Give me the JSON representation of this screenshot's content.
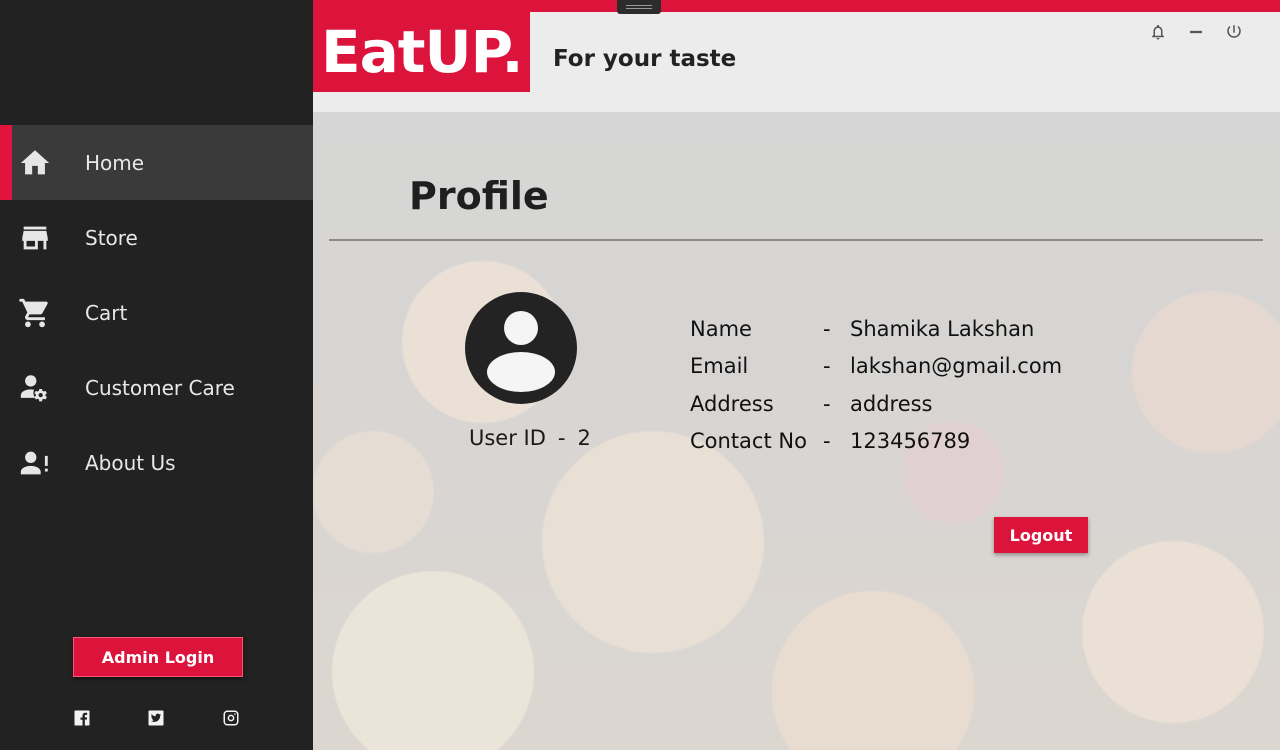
{
  "brand": {
    "logo_text": "EatUP.",
    "tagline": "For your taste"
  },
  "sidebar": {
    "items": [
      {
        "label": "Home",
        "icon": "home-icon",
        "active": true
      },
      {
        "label": "Store",
        "icon": "store-icon",
        "active": false
      },
      {
        "label": "Cart",
        "icon": "cart-icon",
        "active": false
      },
      {
        "label": "Customer Care",
        "icon": "user-gear-icon",
        "active": false
      },
      {
        "label": "About Us",
        "icon": "user-alert-icon",
        "active": false
      }
    ],
    "admin_login_label": "Admin Login",
    "social": [
      "facebook-icon",
      "twitter-icon",
      "instagram-icon"
    ]
  },
  "window_controls": [
    "bell-icon",
    "minimize-icon",
    "power-icon"
  ],
  "profile": {
    "title": "Profile",
    "user_id_label": "User ID",
    "user_id_sep": "-",
    "user_id_value": "2",
    "fields": [
      {
        "label": "Name",
        "sep": "-",
        "value": "Shamika Lakshan"
      },
      {
        "label": "Email",
        "sep": "-",
        "value": "lakshan@gmail.com"
      },
      {
        "label": "Address",
        "sep": "-",
        "value": "address"
      },
      {
        "label": "Contact No",
        "sep": "-",
        "value": "123456789"
      }
    ],
    "logout_label": "Logout"
  },
  "colors": {
    "accent": "#dc143c",
    "sidebar_bg": "#222222",
    "sidebar_active_bg": "#3a3a3a",
    "content_bg": "#ececec"
  }
}
